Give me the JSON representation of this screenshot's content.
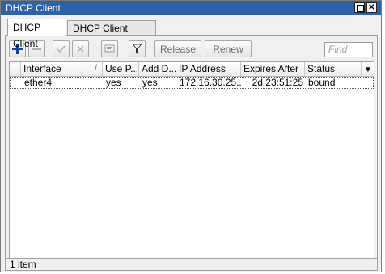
{
  "window": {
    "title": "DHCP Client"
  },
  "tabs": [
    {
      "label": "DHCP Client"
    },
    {
      "label": "DHCP Client Options"
    }
  ],
  "toolbar": {
    "add_icon": "plus-icon",
    "remove_icon": "minus-icon",
    "enable_icon": "check-icon",
    "disable_icon": "cross-icon",
    "comment_icon": "comment-icon",
    "filter_icon": "filter-icon",
    "release_label": "Release",
    "renew_label": "Renew",
    "find_placeholder": "Find"
  },
  "table": {
    "columns": [
      "Interface",
      "Use P...",
      "Add D...",
      "IP Address",
      "Expires After",
      "Status"
    ],
    "rows": [
      [
        "ether4",
        "yes",
        "yes",
        "172.16.30.25...",
        "2d 23:51:25",
        "bound"
      ]
    ]
  },
  "status": {
    "count": "1 item"
  },
  "colors": {
    "titlebar": "#2e62a8",
    "add_icon": "#1a3f9c"
  }
}
